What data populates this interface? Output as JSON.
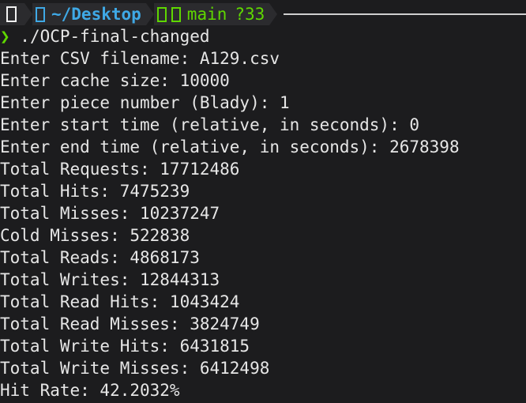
{
  "prompt": {
    "dir": "~/Desktop",
    "branch": "main",
    "git_status": "?33",
    "arrow": "❯",
    "command": " ./OCP-final-changed"
  },
  "output": [
    "Enter CSV filename: A129.csv",
    "Enter cache size: 10000",
    "Enter piece number (Blady): 1",
    "Enter start time (relative, in seconds): 0",
    "Enter end time (relative, in seconds): 2678398",
    "Total Requests: 17712486",
    "Total Hits: 7475239",
    "Total Misses: 10237247",
    "Cold Misses: 522838",
    "Total Reads: 4868173",
    "Total Writes: 12844313",
    "Total Read Hits: 1043424",
    "Total Read Misses: 3824749",
    "Total Write Hits: 6431815",
    "Total Write Misses: 6412498",
    "Hit Rate: 42.2032%"
  ],
  "colors": {
    "background": "#1c1c1e",
    "text": "#e6e6e6",
    "dir": "#3fa9e6",
    "git": "#5fd700",
    "arrow": "#5fd700"
  },
  "icons": {
    "os": "apple-logo-icon",
    "folder": "folder-icon",
    "git_branch": "git-branch-icon",
    "git_icon": "git-icon"
  }
}
